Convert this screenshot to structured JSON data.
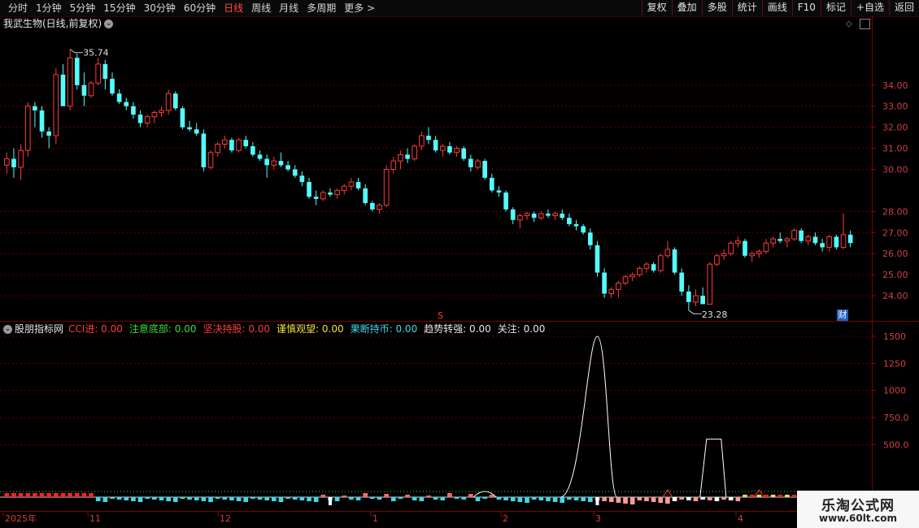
{
  "toolbar": {
    "periods": [
      {
        "label": "分时",
        "active": false
      },
      {
        "label": "1分钟",
        "active": false
      },
      {
        "label": "5分钟",
        "active": false
      },
      {
        "label": "15分钟",
        "active": false
      },
      {
        "label": "30分钟",
        "active": false
      },
      {
        "label": "60分钟",
        "active": false
      },
      {
        "label": "日线",
        "active": true
      },
      {
        "label": "周线",
        "active": false
      },
      {
        "label": "月线",
        "active": false
      },
      {
        "label": "多周期",
        "active": false
      },
      {
        "label": "更多 >",
        "active": false
      }
    ],
    "tools": [
      "复权",
      "叠加",
      "多股",
      "统计",
      "画线",
      "F10",
      "标记",
      "+自选",
      "返回"
    ]
  },
  "main_chart": {
    "title": "我武生物(日线,前复权)",
    "high_label": "35.74",
    "low_label": "23.28",
    "s_marker": "S",
    "cai_badge": "财",
    "y_ticks": [
      "34.00",
      "33.00",
      "32.00",
      "31.00",
      "30.00",
      "28.00",
      "27.00",
      "26.00",
      "25.00",
      "24.00"
    ]
  },
  "indicator": {
    "name": "股朋指标网",
    "items": [
      {
        "label": "CCI进: 0.00",
        "color": "#ff3b3b"
      },
      {
        "label": "注意底部: 0.00",
        "color": "#3cdc3c"
      },
      {
        "label": "坚决持股: 0.00",
        "color": "#ff3b3b"
      },
      {
        "label": "谨慎观望: 0.00",
        "color": "#f0e040"
      },
      {
        "label": "果断持币: 0.00",
        "color": "#40d8e8"
      },
      {
        "label": "趋势转强: 0.00",
        "color": "#e6e6e6"
      },
      {
        "label": "关注: 0.00",
        "color": "#e6e6e6"
      }
    ],
    "y_ticks": [
      "1500",
      "1250",
      "1000",
      "750.0",
      "500.0"
    ]
  },
  "time_axis": [
    "2025年",
    "11",
    "12",
    "1",
    "2",
    "3",
    "4"
  ],
  "watermark": {
    "title": "乐淘公式网",
    "url": "www.60lt.com"
  },
  "chart_data": {
    "type": "candlestick",
    "ylim": [
      23.0,
      36.5
    ],
    "candles": [
      [
        30.2,
        30.8,
        29.8,
        30.5
      ],
      [
        30.5,
        31.0,
        29.6,
        30.1
      ],
      [
        30.1,
        31.2,
        29.5,
        30.9
      ],
      [
        30.9,
        33.2,
        30.6,
        33.0
      ],
      [
        33.0,
        33.2,
        32.0,
        32.8
      ],
      [
        32.8,
        33.0,
        31.5,
        31.8
      ],
      [
        31.8,
        32.0,
        31.0,
        31.6
      ],
      [
        31.6,
        34.8,
        31.2,
        34.5
      ],
      [
        34.5,
        35.0,
        33.5,
        33.0
      ],
      [
        33.0,
        35.7,
        32.8,
        35.3
      ],
      [
        35.3,
        35.5,
        33.8,
        34.0
      ],
      [
        34.0,
        34.6,
        33.0,
        33.5
      ],
      [
        33.5,
        34.2,
        33.4,
        34.1
      ],
      [
        34.1,
        35.3,
        34.0,
        35.0
      ],
      [
        35.0,
        35.2,
        33.8,
        34.3
      ],
      [
        34.3,
        34.6,
        33.5,
        33.6
      ],
      [
        33.6,
        33.8,
        33.1,
        33.2
      ],
      [
        33.2,
        33.4,
        32.8,
        33.0
      ],
      [
        33.0,
        33.2,
        32.4,
        32.6
      ],
      [
        32.6,
        32.8,
        32.0,
        32.2
      ],
      [
        32.2,
        32.6,
        32.0,
        32.5
      ],
      [
        32.5,
        32.8,
        32.2,
        32.7
      ],
      [
        32.7,
        33.0,
        32.5,
        32.8
      ],
      [
        32.8,
        33.8,
        32.6,
        33.6
      ],
      [
        33.6,
        33.7,
        32.8,
        32.9
      ],
      [
        32.9,
        33.0,
        31.9,
        32.0
      ],
      [
        32.0,
        32.3,
        31.8,
        31.9
      ],
      [
        31.9,
        32.2,
        31.6,
        31.7
      ],
      [
        31.7,
        31.9,
        29.9,
        30.1
      ],
      [
        30.1,
        30.9,
        30.0,
        30.8
      ],
      [
        30.8,
        31.3,
        30.6,
        31.2
      ],
      [
        31.2,
        31.6,
        31.0,
        31.4
      ],
      [
        31.4,
        31.5,
        30.8,
        30.9
      ],
      [
        30.9,
        31.5,
        30.8,
        31.4
      ],
      [
        31.4,
        31.6,
        31.0,
        31.1
      ],
      [
        31.1,
        31.3,
        30.6,
        30.7
      ],
      [
        30.7,
        30.9,
        30.4,
        30.5
      ],
      [
        30.5,
        30.7,
        29.6,
        30.2
      ],
      [
        30.2,
        30.6,
        30.0,
        30.4
      ],
      [
        30.4,
        30.8,
        30.1,
        30.2
      ],
      [
        30.2,
        30.4,
        29.9,
        30.0
      ],
      [
        30.0,
        30.2,
        29.6,
        29.7
      ],
      [
        29.7,
        29.9,
        29.2,
        29.4
      ],
      [
        29.4,
        29.6,
        28.6,
        28.7
      ],
      [
        28.7,
        29.0,
        28.3,
        28.6
      ],
      [
        28.6,
        29.0,
        28.5,
        28.9
      ],
      [
        28.9,
        29.1,
        28.7,
        28.8
      ],
      [
        28.8,
        29.1,
        28.6,
        29.0
      ],
      [
        29.0,
        29.3,
        28.8,
        29.2
      ],
      [
        29.2,
        29.6,
        29.0,
        29.4
      ],
      [
        29.4,
        29.6,
        29.0,
        29.1
      ],
      [
        29.1,
        29.3,
        28.3,
        28.4
      ],
      [
        28.4,
        28.5,
        28.0,
        28.1
      ],
      [
        28.1,
        28.4,
        27.9,
        28.3
      ],
      [
        28.3,
        30.2,
        28.2,
        30.0
      ],
      [
        30.0,
        30.6,
        29.8,
        30.4
      ],
      [
        30.4,
        30.9,
        30.0,
        30.7
      ],
      [
        30.7,
        31.0,
        30.3,
        30.5
      ],
      [
        30.5,
        31.2,
        30.4,
        31.1
      ],
      [
        31.1,
        31.8,
        30.9,
        31.6
      ],
      [
        31.6,
        32.0,
        31.2,
        31.4
      ],
      [
        31.4,
        31.6,
        30.8,
        30.9
      ],
      [
        30.9,
        31.2,
        30.6,
        31.1
      ],
      [
        31.1,
        31.3,
        30.7,
        30.8
      ],
      [
        30.8,
        31.1,
        30.6,
        31.0
      ],
      [
        31.0,
        31.1,
        30.4,
        30.5
      ],
      [
        30.5,
        30.7,
        29.9,
        30.1
      ],
      [
        30.1,
        30.5,
        30.0,
        30.4
      ],
      [
        30.4,
        30.5,
        29.5,
        29.6
      ],
      [
        29.6,
        29.8,
        28.9,
        29.0
      ],
      [
        29.0,
        29.2,
        28.7,
        28.9
      ],
      [
        28.9,
        29.0,
        28.0,
        28.1
      ],
      [
        28.1,
        28.2,
        27.4,
        27.6
      ],
      [
        27.6,
        27.9,
        27.2,
        27.8
      ],
      [
        27.8,
        28.0,
        27.6,
        27.9
      ],
      [
        27.9,
        28.0,
        27.5,
        27.7
      ],
      [
        27.7,
        28.0,
        27.6,
        27.9
      ],
      [
        27.9,
        28.1,
        27.7,
        27.8
      ],
      [
        27.8,
        28.0,
        27.6,
        27.9
      ],
      [
        27.9,
        28.1,
        27.6,
        27.7
      ],
      [
        27.7,
        27.9,
        27.3,
        27.4
      ],
      [
        27.4,
        27.6,
        27.1,
        27.3
      ],
      [
        27.3,
        27.4,
        26.9,
        27.0
      ],
      [
        27.0,
        27.2,
        26.2,
        26.4
      ],
      [
        26.4,
        26.6,
        24.9,
        25.1
      ],
      [
        25.1,
        25.3,
        23.9,
        24.1
      ],
      [
        24.1,
        24.4,
        23.9,
        24.3
      ],
      [
        24.3,
        24.7,
        23.9,
        24.6
      ],
      [
        24.6,
        25.0,
        24.5,
        24.9
      ],
      [
        24.9,
        25.1,
        24.7,
        25.0
      ],
      [
        25.0,
        25.4,
        24.9,
        25.3
      ],
      [
        25.3,
        25.6,
        25.1,
        25.5
      ],
      [
        25.5,
        25.6,
        25.1,
        25.2
      ],
      [
        25.2,
        26.0,
        25.1,
        25.9
      ],
      [
        25.9,
        26.6,
        25.8,
        26.2
      ],
      [
        26.2,
        26.3,
        25.0,
        25.1
      ],
      [
        25.1,
        25.3,
        24.0,
        24.2
      ],
      [
        24.2,
        24.5,
        23.3,
        23.7
      ],
      [
        23.7,
        24.3,
        23.5,
        24.0
      ],
      [
        24.0,
        24.4,
        23.7,
        23.6
      ],
      [
        23.6,
        25.6,
        23.6,
        25.5
      ],
      [
        25.5,
        26.0,
        25.4,
        25.9
      ],
      [
        25.9,
        26.2,
        25.7,
        26.0
      ],
      [
        26.0,
        26.6,
        25.9,
        26.5
      ],
      [
        26.5,
        26.8,
        26.3,
        26.6
      ],
      [
        26.6,
        26.7,
        25.8,
        25.9
      ],
      [
        25.9,
        26.1,
        25.6,
        26.0
      ],
      [
        26.0,
        26.2,
        25.8,
        26.1
      ],
      [
        26.1,
        26.7,
        26.0,
        26.5
      ],
      [
        26.5,
        26.8,
        26.3,
        26.7
      ],
      [
        26.7,
        27.0,
        26.5,
        26.6
      ],
      [
        26.6,
        26.8,
        26.3,
        26.7
      ],
      [
        26.7,
        27.2,
        26.6,
        27.1
      ],
      [
        27.1,
        27.2,
        26.5,
        26.6
      ],
      [
        26.6,
        26.9,
        26.4,
        26.8
      ],
      [
        26.8,
        27.0,
        26.4,
        26.5
      ],
      [
        26.5,
        26.7,
        26.1,
        26.3
      ],
      [
        26.3,
        26.9,
        26.1,
        26.8
      ],
      [
        26.8,
        26.9,
        26.2,
        26.3
      ],
      [
        26.3,
        27.9,
        26.2,
        26.9
      ],
      [
        26.9,
        27.1,
        26.3,
        26.5
      ]
    ],
    "cci_peaks": [
      {
        "bar_index": 84,
        "value": 1500
      },
      {
        "bar_index": 100,
        "value": 550
      }
    ]
  }
}
